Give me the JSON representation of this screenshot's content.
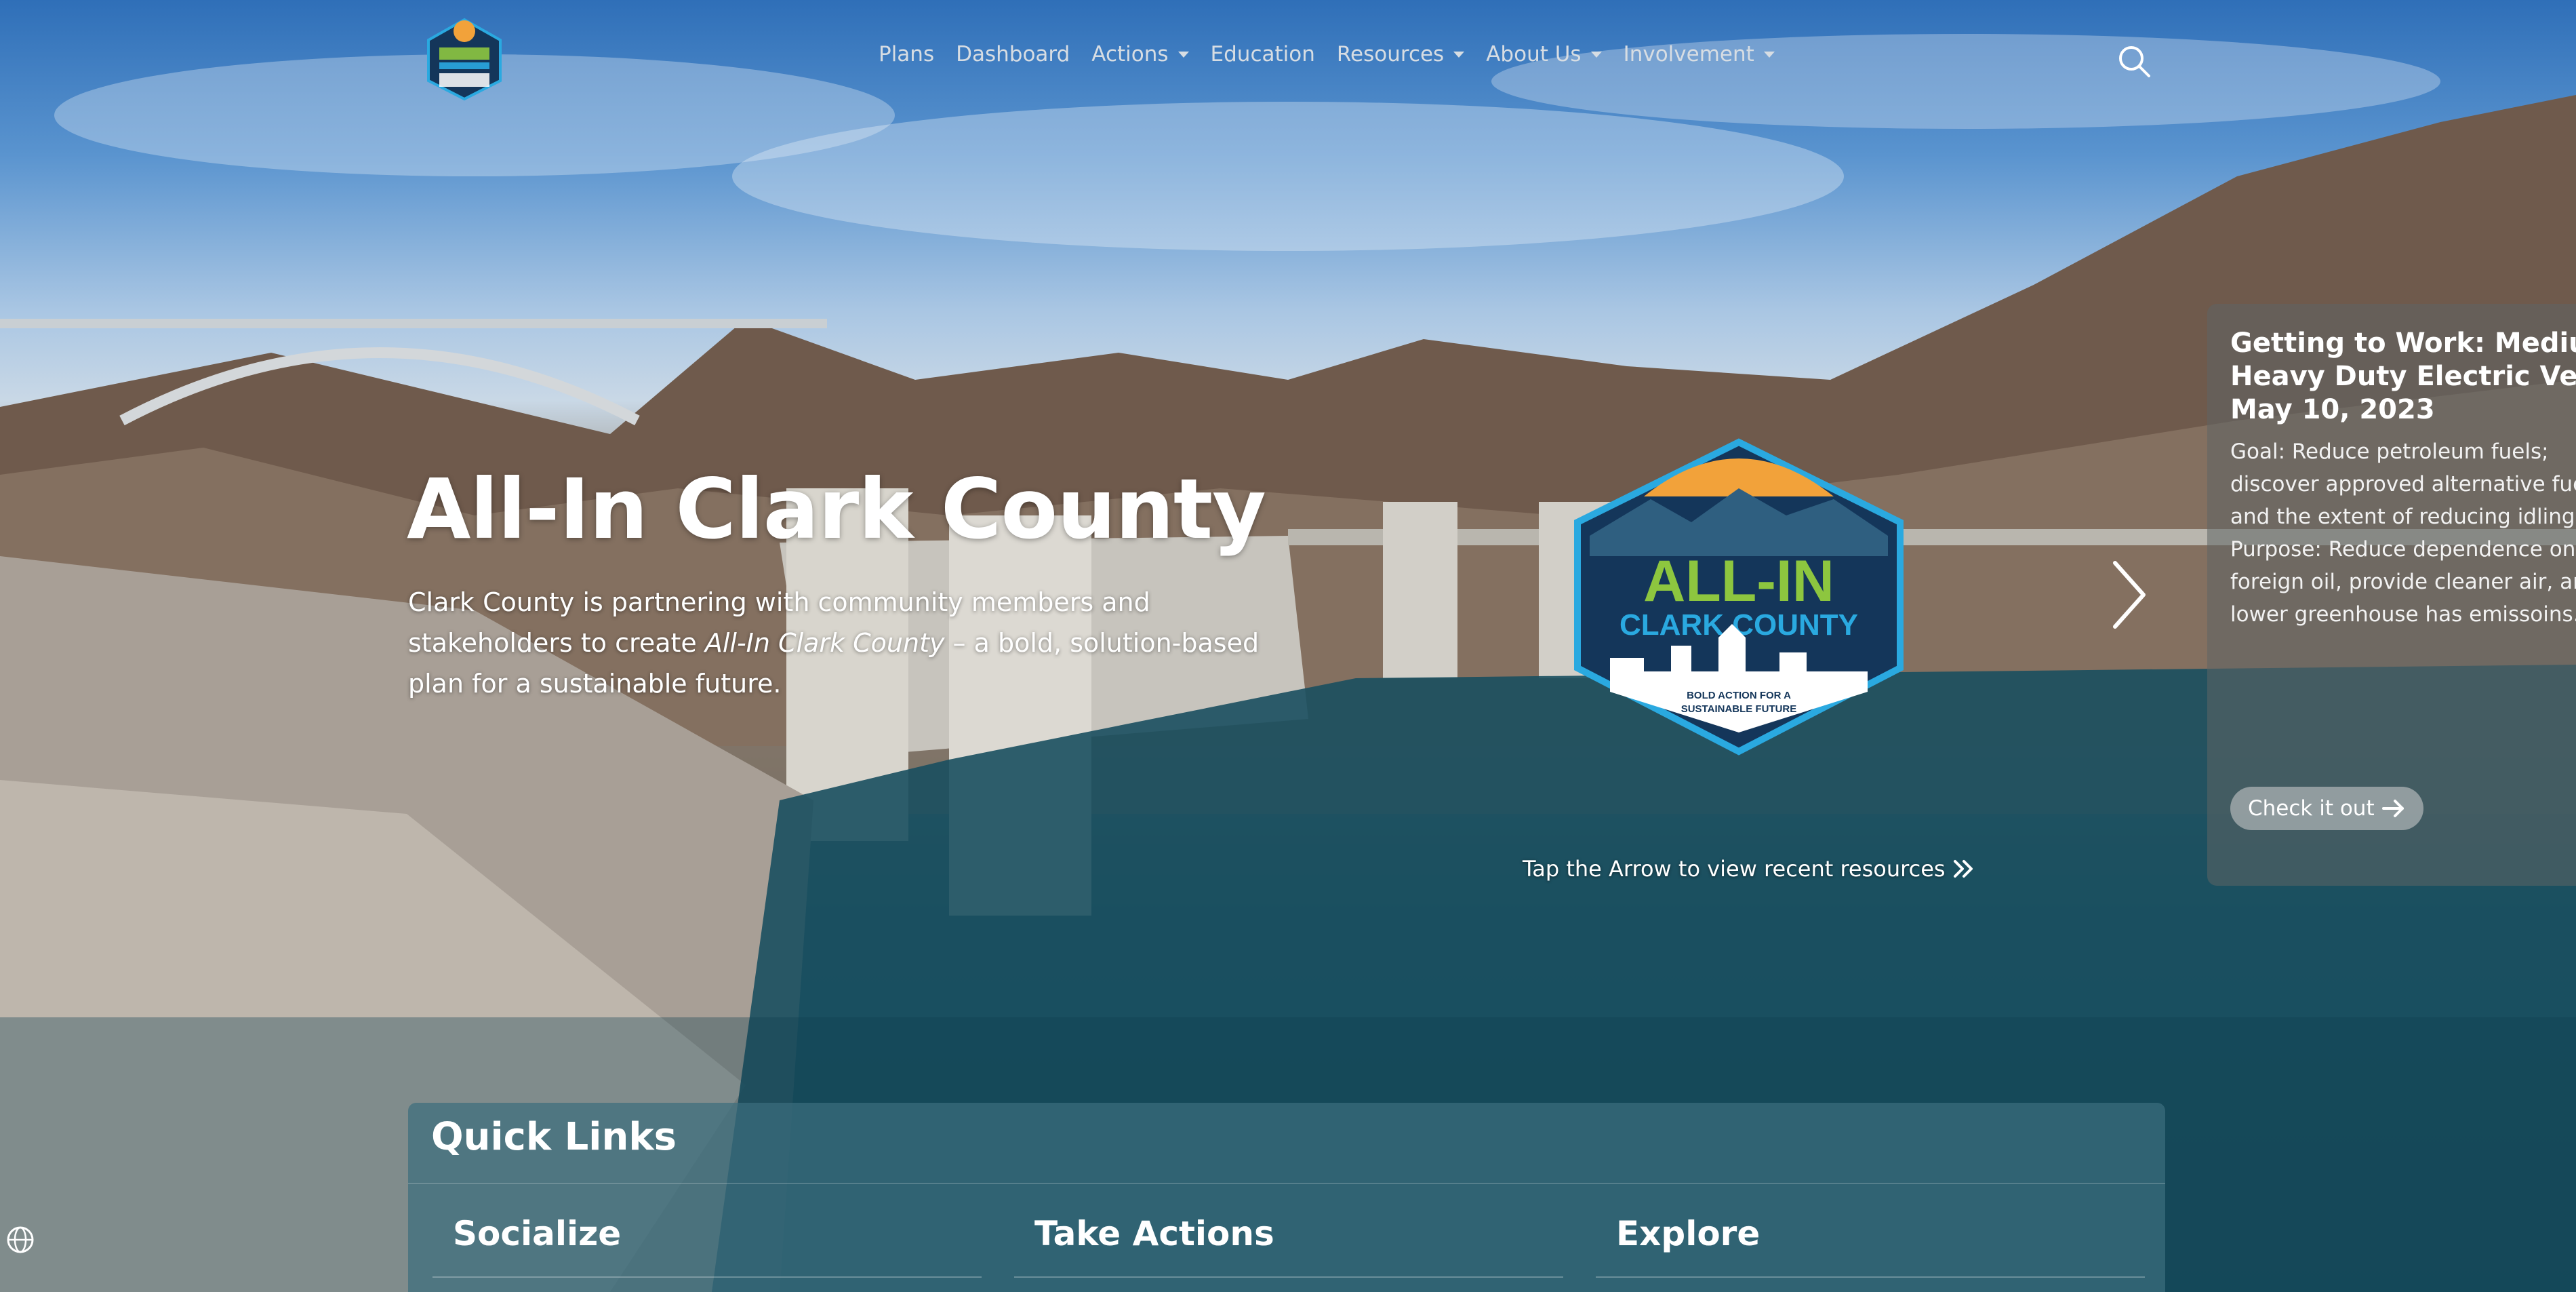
{
  "site": {
    "logo_alt": "ALL-IN CLARK COUNTY"
  },
  "nav": {
    "items": [
      {
        "label": "Plans",
        "dropdown": false
      },
      {
        "label": "Dashboard",
        "dropdown": false
      },
      {
        "label": "Actions",
        "dropdown": true
      },
      {
        "label": "Education",
        "dropdown": false
      },
      {
        "label": "Resources",
        "dropdown": true
      },
      {
        "label": "About Us",
        "dropdown": true
      },
      {
        "label": "Involvement",
        "dropdown": true
      }
    ],
    "search_icon": "search-icon"
  },
  "hero": {
    "title": "All-In Clark County",
    "desc_pre": "Clark County is partnering with community members and stakeholders to create ",
    "desc_em": "All-In Clark County",
    "desc_post": " – a bold, solution-based plan for a sustainable future.",
    "badge": {
      "line1": "ALL-IN",
      "line2": "CLARK COUNTY",
      "tagline1": "BOLD ACTION FOR A",
      "tagline2": "SUSTAINABLE FUTURE"
    },
    "tap_text": "Tap the Arrow to view recent resources",
    "next_icon": "chevron-right-icon"
  },
  "resource_card": {
    "title_lines": [
      "Getting to Work: Medium and",
      "Heavy Duty Electric Vehicles",
      "May 10, 2023"
    ],
    "body_lines": [
      "Goal: Reduce petroleum fuels;",
      "discover approved alternative fuels",
      "and the extent of reducing idling.",
      "Purpose: Reduce dependence on",
      "foreign oil, provide cleaner air, and",
      "lower greenhouse has emissoins."
    ],
    "button_label": "Check it out"
  },
  "quick_links": {
    "title": "Quick Links",
    "columns": [
      "Socialize",
      "Take Actions",
      "Explore"
    ]
  },
  "colors": {
    "badge_green": "#8dc63f",
    "badge_blue": "#2aa9e0",
    "badge_navy": "#14365a",
    "badge_orange": "#f2a23a"
  },
  "footer": {
    "language_icon": "globe-icon"
  }
}
